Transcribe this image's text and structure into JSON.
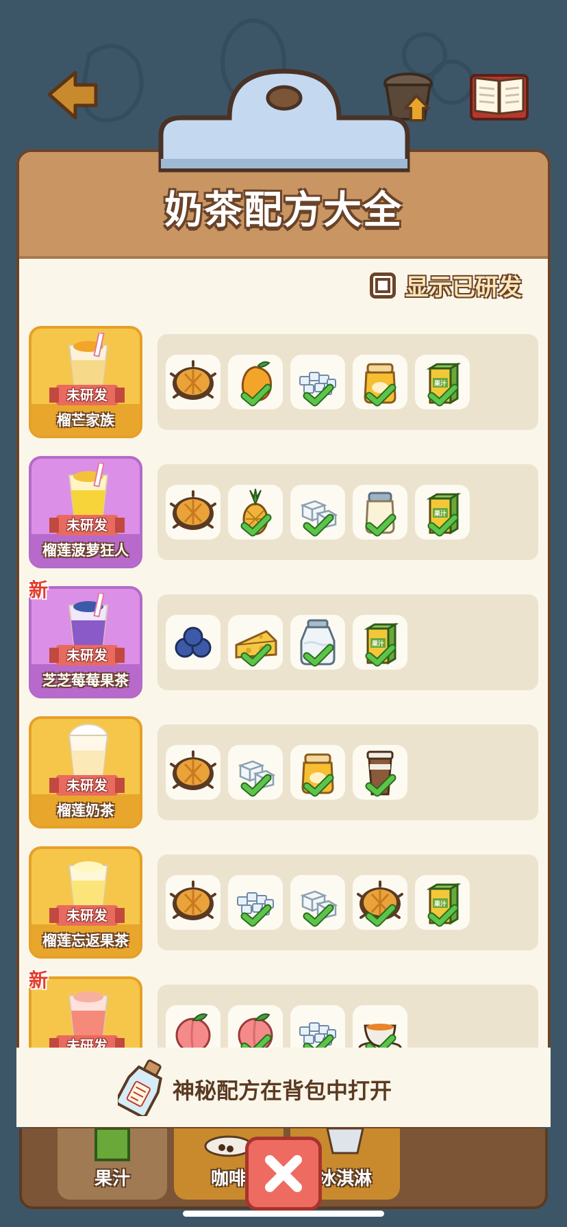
{
  "title": "奶茶配方大全",
  "toggle": {
    "label": "显示已研发",
    "checked": false
  },
  "status_label": "未研发",
  "new_label": "新",
  "recipes": [
    {
      "name": "榴芒家族",
      "color": "gold",
      "is_new": false,
      "drink": "mango-drink",
      "ingredients": [
        {
          "icon": "durian-icon",
          "checked": false
        },
        {
          "icon": "mango-icon",
          "checked": true
        },
        {
          "icon": "crushed-ice-icon",
          "checked": true
        },
        {
          "icon": "honey-jar-icon",
          "checked": true
        },
        {
          "icon": "juice-box-icon",
          "checked": true
        }
      ]
    },
    {
      "name": "榴莲菠萝狂人",
      "color": "purple",
      "is_new": false,
      "drink": "pineapple-drink",
      "ingredients": [
        {
          "icon": "durian-icon",
          "checked": false
        },
        {
          "icon": "pineapple-icon",
          "checked": true
        },
        {
          "icon": "ice-cubes-icon",
          "checked": true
        },
        {
          "icon": "milk-jar-icon",
          "checked": true
        },
        {
          "icon": "juice-box-icon",
          "checked": true
        }
      ]
    },
    {
      "name": "芝芝莓莓果茶",
      "color": "purple",
      "is_new": true,
      "drink": "blueberry-drink",
      "ingredients": [
        {
          "icon": "blueberry-icon",
          "checked": false
        },
        {
          "icon": "cheese-icon",
          "checked": true
        },
        {
          "icon": "milk-bottle-icon",
          "checked": true
        },
        {
          "icon": "juice-box-icon",
          "checked": true
        }
      ]
    },
    {
      "name": "榴莲奶茶",
      "color": "gold",
      "is_new": false,
      "drink": "milk-tea-drink",
      "ingredients": [
        {
          "icon": "durian-icon",
          "checked": false
        },
        {
          "icon": "ice-cubes-icon",
          "checked": true
        },
        {
          "icon": "honey-jar-icon",
          "checked": true
        },
        {
          "icon": "coffee-cup-icon",
          "checked": true
        }
      ]
    },
    {
      "name": "榴莲忘返果茶",
      "color": "gold",
      "is_new": false,
      "drink": "yellow-fruit-tea",
      "ingredients": [
        {
          "icon": "durian-icon",
          "checked": false
        },
        {
          "icon": "crushed-ice-icon",
          "checked": true
        },
        {
          "icon": "ice-cubes-icon",
          "checked": true
        },
        {
          "icon": "durian-icon",
          "checked": true
        },
        {
          "icon": "juice-box-icon",
          "checked": true
        }
      ]
    },
    {
      "name": "",
      "color": "gold",
      "is_new": true,
      "drink": "peach-drink",
      "ingredients": [
        {
          "icon": "peach-icon",
          "checked": false
        },
        {
          "icon": "peach-icon",
          "checked": true
        },
        {
          "icon": "crushed-ice-icon",
          "checked": true
        },
        {
          "icon": "tea-cup-icon",
          "checked": true
        }
      ]
    }
  ],
  "footer_hint": "神秘配方在背包中打开",
  "tray_tabs": [
    {
      "label": "果汁"
    },
    {
      "label": "咖啡"
    },
    {
      "label": "冰淇淋"
    }
  ],
  "juice_box_text": "果汁",
  "colors": {
    "background": "#3d5667",
    "header": "#c99563",
    "board": "#fbf6ea",
    "card_gold": "#f6c64a",
    "card_purple": "#dc8fe6",
    "check": "#5cc44a"
  }
}
